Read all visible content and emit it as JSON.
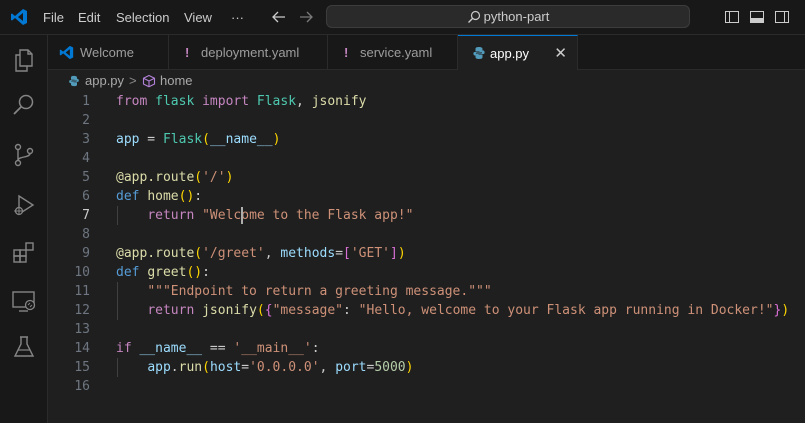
{
  "menu": [
    "File",
    "Edit",
    "Selection",
    "View",
    "···"
  ],
  "search": {
    "text": "python-part"
  },
  "tabs": [
    {
      "icon": "vscode-logo-icon",
      "label": "Welcome",
      "active": false
    },
    {
      "icon": "yaml-warning-icon",
      "label": "deployment.yaml",
      "active": false
    },
    {
      "icon": "yaml-warning-icon",
      "label": "service.yaml",
      "active": false
    },
    {
      "icon": "python-icon",
      "label": "app.py",
      "active": true,
      "close": "✕"
    }
  ],
  "breadcrumb": {
    "file": "app.py",
    "separator": ">",
    "symbol": "home"
  },
  "editor": {
    "current_line": 7,
    "lines": [
      {
        "n": "1",
        "tokens": [
          [
            "k",
            "from"
          ],
          [
            "w",
            " "
          ],
          [
            "c",
            "flask"
          ],
          [
            "w",
            " "
          ],
          [
            "k",
            "import"
          ],
          [
            "w",
            " "
          ],
          [
            "c",
            "Flask"
          ],
          [
            "w",
            ", "
          ],
          [
            "f",
            "jsonify"
          ]
        ]
      },
      {
        "n": "2",
        "tokens": []
      },
      {
        "n": "3",
        "tokens": [
          [
            "v",
            "app"
          ],
          [
            "w",
            " = "
          ],
          [
            "c",
            "Flask"
          ],
          [
            "p1",
            "("
          ],
          [
            "v",
            "__name__"
          ],
          [
            "p1",
            ")"
          ]
        ]
      },
      {
        "n": "4",
        "tokens": []
      },
      {
        "n": "5",
        "tokens": [
          [
            "f",
            "@app.route"
          ],
          [
            "p1",
            "("
          ],
          [
            "s",
            "'/'"
          ],
          [
            "p1",
            ")"
          ]
        ]
      },
      {
        "n": "6",
        "tokens": [
          [
            "kd",
            "def"
          ],
          [
            "w",
            " "
          ],
          [
            "f",
            "home"
          ],
          [
            "p1",
            "()"
          ],
          [
            "w",
            ":"
          ]
        ]
      },
      {
        "n": "7",
        "tokens": [
          [
            "w",
            "    "
          ],
          [
            "k",
            "return"
          ],
          [
            "w",
            " "
          ],
          [
            "s",
            "\"Welcome to the Flask app!\""
          ]
        ]
      },
      {
        "n": "8",
        "tokens": []
      },
      {
        "n": "9",
        "tokens": [
          [
            "f",
            "@app.route"
          ],
          [
            "p1",
            "("
          ],
          [
            "s",
            "'/greet'"
          ],
          [
            "w",
            ", "
          ],
          [
            "v",
            "methods"
          ],
          [
            "w",
            "="
          ],
          [
            "p2",
            "["
          ],
          [
            "s",
            "'GET'"
          ],
          [
            "p2",
            "]"
          ],
          [
            "p1",
            ")"
          ]
        ]
      },
      {
        "n": "10",
        "tokens": [
          [
            "kd",
            "def"
          ],
          [
            "w",
            " "
          ],
          [
            "f",
            "greet"
          ],
          [
            "p1",
            "()"
          ],
          [
            "w",
            ":"
          ]
        ]
      },
      {
        "n": "11",
        "tokens": [
          [
            "w",
            "    "
          ],
          [
            "s",
            "\"\"\"Endpoint to return a greeting message.\"\"\""
          ]
        ]
      },
      {
        "n": "12",
        "tokens": [
          [
            "w",
            "    "
          ],
          [
            "k",
            "return"
          ],
          [
            "w",
            " "
          ],
          [
            "f",
            "jsonify"
          ],
          [
            "p1",
            "("
          ],
          [
            "p2",
            "{"
          ],
          [
            "s",
            "\"message\""
          ],
          [
            "w",
            ": "
          ],
          [
            "s",
            "\"Hello, welcome to your Flask app running in Docker!\""
          ],
          [
            "p2",
            "}"
          ],
          [
            "p1",
            ")"
          ]
        ]
      },
      {
        "n": "13",
        "tokens": []
      },
      {
        "n": "14",
        "tokens": [
          [
            "k",
            "if"
          ],
          [
            "w",
            " "
          ],
          [
            "v",
            "__name__"
          ],
          [
            "w",
            " == "
          ],
          [
            "s",
            "'__main__'"
          ],
          [
            "w",
            ":"
          ]
        ]
      },
      {
        "n": "15",
        "tokens": [
          [
            "w",
            "    "
          ],
          [
            "v",
            "app"
          ],
          [
            "w",
            "."
          ],
          [
            "f",
            "run"
          ],
          [
            "p1",
            "("
          ],
          [
            "v",
            "host"
          ],
          [
            "w",
            "="
          ],
          [
            "s",
            "'0.0.0.0'"
          ],
          [
            "w",
            ", "
          ],
          [
            "v",
            "port"
          ],
          [
            "w",
            "="
          ],
          [
            "n",
            "5000"
          ],
          [
            "p1",
            ")"
          ]
        ]
      },
      {
        "n": "16",
        "tokens": []
      }
    ]
  },
  "colors": {
    "accent": "#0078d4",
    "background": "#1f1f1f",
    "chrome": "#181818"
  },
  "activity_bar": [
    "explorer-icon",
    "search-icon",
    "source-control-icon",
    "run-debug-icon",
    "extensions-icon",
    "remote-explorer-icon",
    "testing-icon"
  ]
}
